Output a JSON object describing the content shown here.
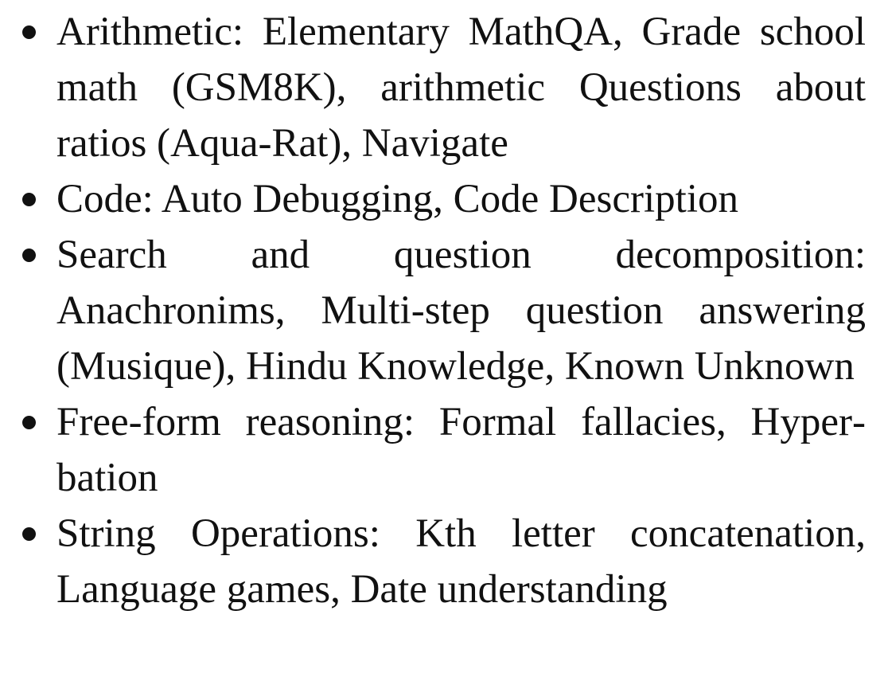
{
  "items": [
    "Arithmetic:  Elementary MathQA, Grade school math (GSM8K), arithmetic Questions about ratios (Aqua-Rat), Navigate",
    "Code: Auto Debugging, Code Description",
    "Search and question decomposition: Anachronims, Multi-step question answering (Musique), Hindu Knowledge, Known Unknown",
    "Free-form reasoning: Formal fallacies, Hyper­bation",
    "String Operations: Kth letter concatenation, Language games, Date understanding"
  ]
}
